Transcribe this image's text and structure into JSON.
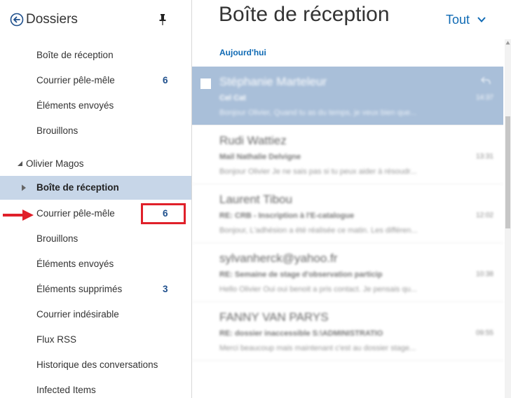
{
  "folder_pane": {
    "title": "Dossiers",
    "favorites": [
      {
        "label": "Boîte de réception",
        "count": ""
      },
      {
        "label": "Courrier pêle-mêle",
        "count": "6"
      },
      {
        "label": "Éléments envoyés",
        "count": ""
      },
      {
        "label": "Brouillons",
        "count": ""
      }
    ],
    "account": {
      "name": "Olivier Magos",
      "folders": [
        {
          "label": "Boîte de réception",
          "count": "",
          "selected": true
        },
        {
          "label": "Courrier pêle-mêle",
          "count": "6"
        },
        {
          "label": "Brouillons",
          "count": ""
        },
        {
          "label": "Éléments envoyés",
          "count": ""
        },
        {
          "label": "Éléments supprimés",
          "count": "3"
        },
        {
          "label": "Courrier indésirable",
          "count": ""
        },
        {
          "label": "Flux RSS",
          "count": ""
        },
        {
          "label": "Historique des conversations",
          "count": ""
        },
        {
          "label": "Infected Items",
          "count": ""
        }
      ]
    }
  },
  "message_pane": {
    "title": "Boîte de réception",
    "filter_label": "Tout",
    "group_header": "Aujourd'hui",
    "messages": [
      {
        "sender": "Stéphanie Marteleur",
        "subject": "Cel Cat",
        "time": "14:37",
        "preview": "Bonjour Olivier, Quand tu as du temps, je veux bien que..."
      },
      {
        "sender": "Rudi Wattiez",
        "subject": "Mail Nathalie Delvigne",
        "time": "13:31",
        "preview": "Bonjour Olivier Je ne sais pas si tu peux aider à résoudr..."
      },
      {
        "sender": "Laurent Tibou",
        "subject": "RE: CRB - Inscription à l'E-catalogue",
        "time": "12:02",
        "preview": "Bonjour, L'adhésion a été réalisée ce matin. Les différen..."
      },
      {
        "sender": "sylvanherck@yahoo.fr",
        "subject": "RE: Semaine de stage d'observation particip",
        "time": "10:38",
        "preview": "Hello Olivier Oui oui benoit a pris contact. Je pensais qu..."
      },
      {
        "sender": "FANNY VAN PARYS",
        "subject": "RE: dossier inaccessible S:\\ADMINISTRATIO",
        "time": "09:55",
        "preview": "Merci beaucoup mais maintenant c'est au dossier stage..."
      }
    ]
  },
  "colors": {
    "accent": "#0f6ab4",
    "selected_folder": "#c7d6e8",
    "selected_message": "#a9bfd9",
    "highlight_box": "#e0202a",
    "arrow": "#e0202a"
  },
  "icons": {
    "back": "circle-arrow-left-icon",
    "pin": "pin-icon",
    "expand": "triangle-expanded-icon",
    "collapse": "triangle-right-icon",
    "filter": "chevron-down-icon",
    "reply": "reply-icon",
    "annotation_arrow": "red-arrow-icon"
  }
}
